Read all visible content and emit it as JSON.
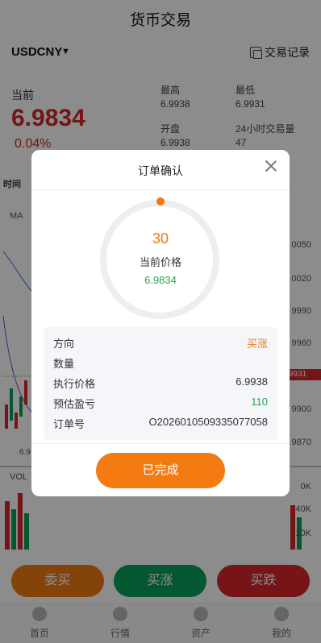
{
  "header": {
    "title": "货币交易",
    "symbol": "USDCNY",
    "records_label": "交易记录"
  },
  "quote": {
    "label": "当前",
    "price": "6.9834",
    "change": "0.04%",
    "high_label": "最高",
    "high": "6.9938",
    "low_label": "最低",
    "low": "6.9931",
    "open_label": "开盘",
    "open": "6.9938",
    "volume_label": "24小时交易量",
    "volume": "47"
  },
  "chart": {
    "tab": "时间",
    "ma_label": "MA",
    "vol_label": "VOL",
    "price_ticks": [
      "0050",
      "0020",
      "9990",
      "9960",
      "9900",
      "9870"
    ],
    "current_price_tag": "9931",
    "low_marker": "6.9",
    "volume_ticks": [
      "0K",
      "40K",
      "10K"
    ],
    "colors": {
      "up": "#0a9e5c",
      "down": "#d8262d"
    }
  },
  "actions": {
    "entrust": "委买",
    "buy": "买涨",
    "sell": "买跌"
  },
  "tabbar": {
    "home": "首页",
    "market": "行情",
    "assets": "资产",
    "mine": "我的"
  },
  "modal": {
    "title": "订单确认",
    "countdown": "30",
    "current_price_label": "当前价格",
    "current_price": "6.9834",
    "rows": [
      {
        "key": "方向",
        "value": "买涨"
      },
      {
        "key": "数量",
        "value": ""
      },
      {
        "key": "执行价格",
        "value": "6.9938"
      },
      {
        "key": "预估盈亏",
        "value": "110"
      },
      {
        "key": "订单号",
        "value": "O2026010509335077058"
      }
    ],
    "done_label": "已完成",
    "accent": "#f47a12"
  }
}
